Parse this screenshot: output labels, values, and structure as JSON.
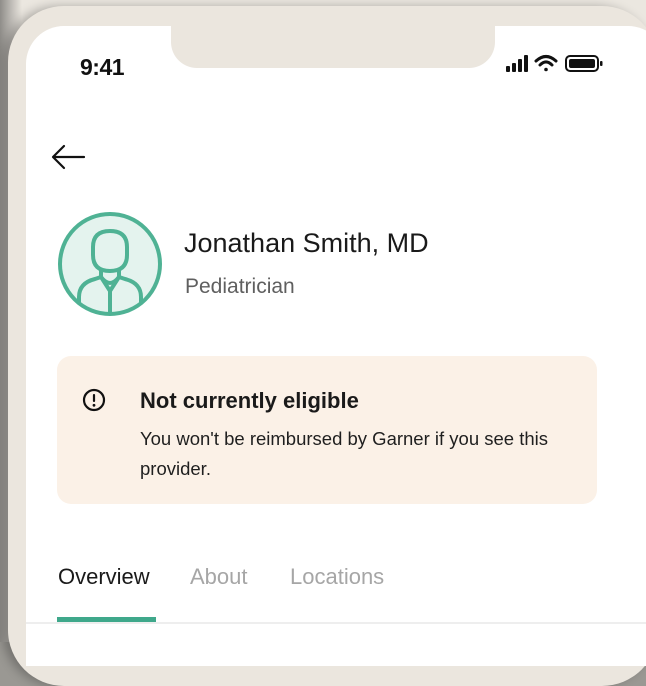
{
  "status_bar": {
    "time": "9:41",
    "icons": [
      "cellular-signal-icon",
      "wifi-icon",
      "battery-icon"
    ]
  },
  "nav": {
    "back_icon": "arrow-left-icon"
  },
  "provider": {
    "avatar_icon": "user-avatar-icon",
    "name": "Jonathan Smith, MD",
    "specialty": "Pediatrician"
  },
  "eligibility_alert": {
    "icon": "exclamation-circle-icon",
    "title": "Not currently eligible",
    "message": "You won't be reimbursed by Garner if you see this provider."
  },
  "tabs": [
    {
      "label": "Overview",
      "active": true
    },
    {
      "label": "About",
      "active": false
    },
    {
      "label": "Locations",
      "active": false
    }
  ],
  "colors": {
    "accent": "#3fa88b",
    "alert_background": "#fbf1e7",
    "avatar_fill": "#e4f3ee",
    "inactive_tab": "#a6a6a6"
  }
}
